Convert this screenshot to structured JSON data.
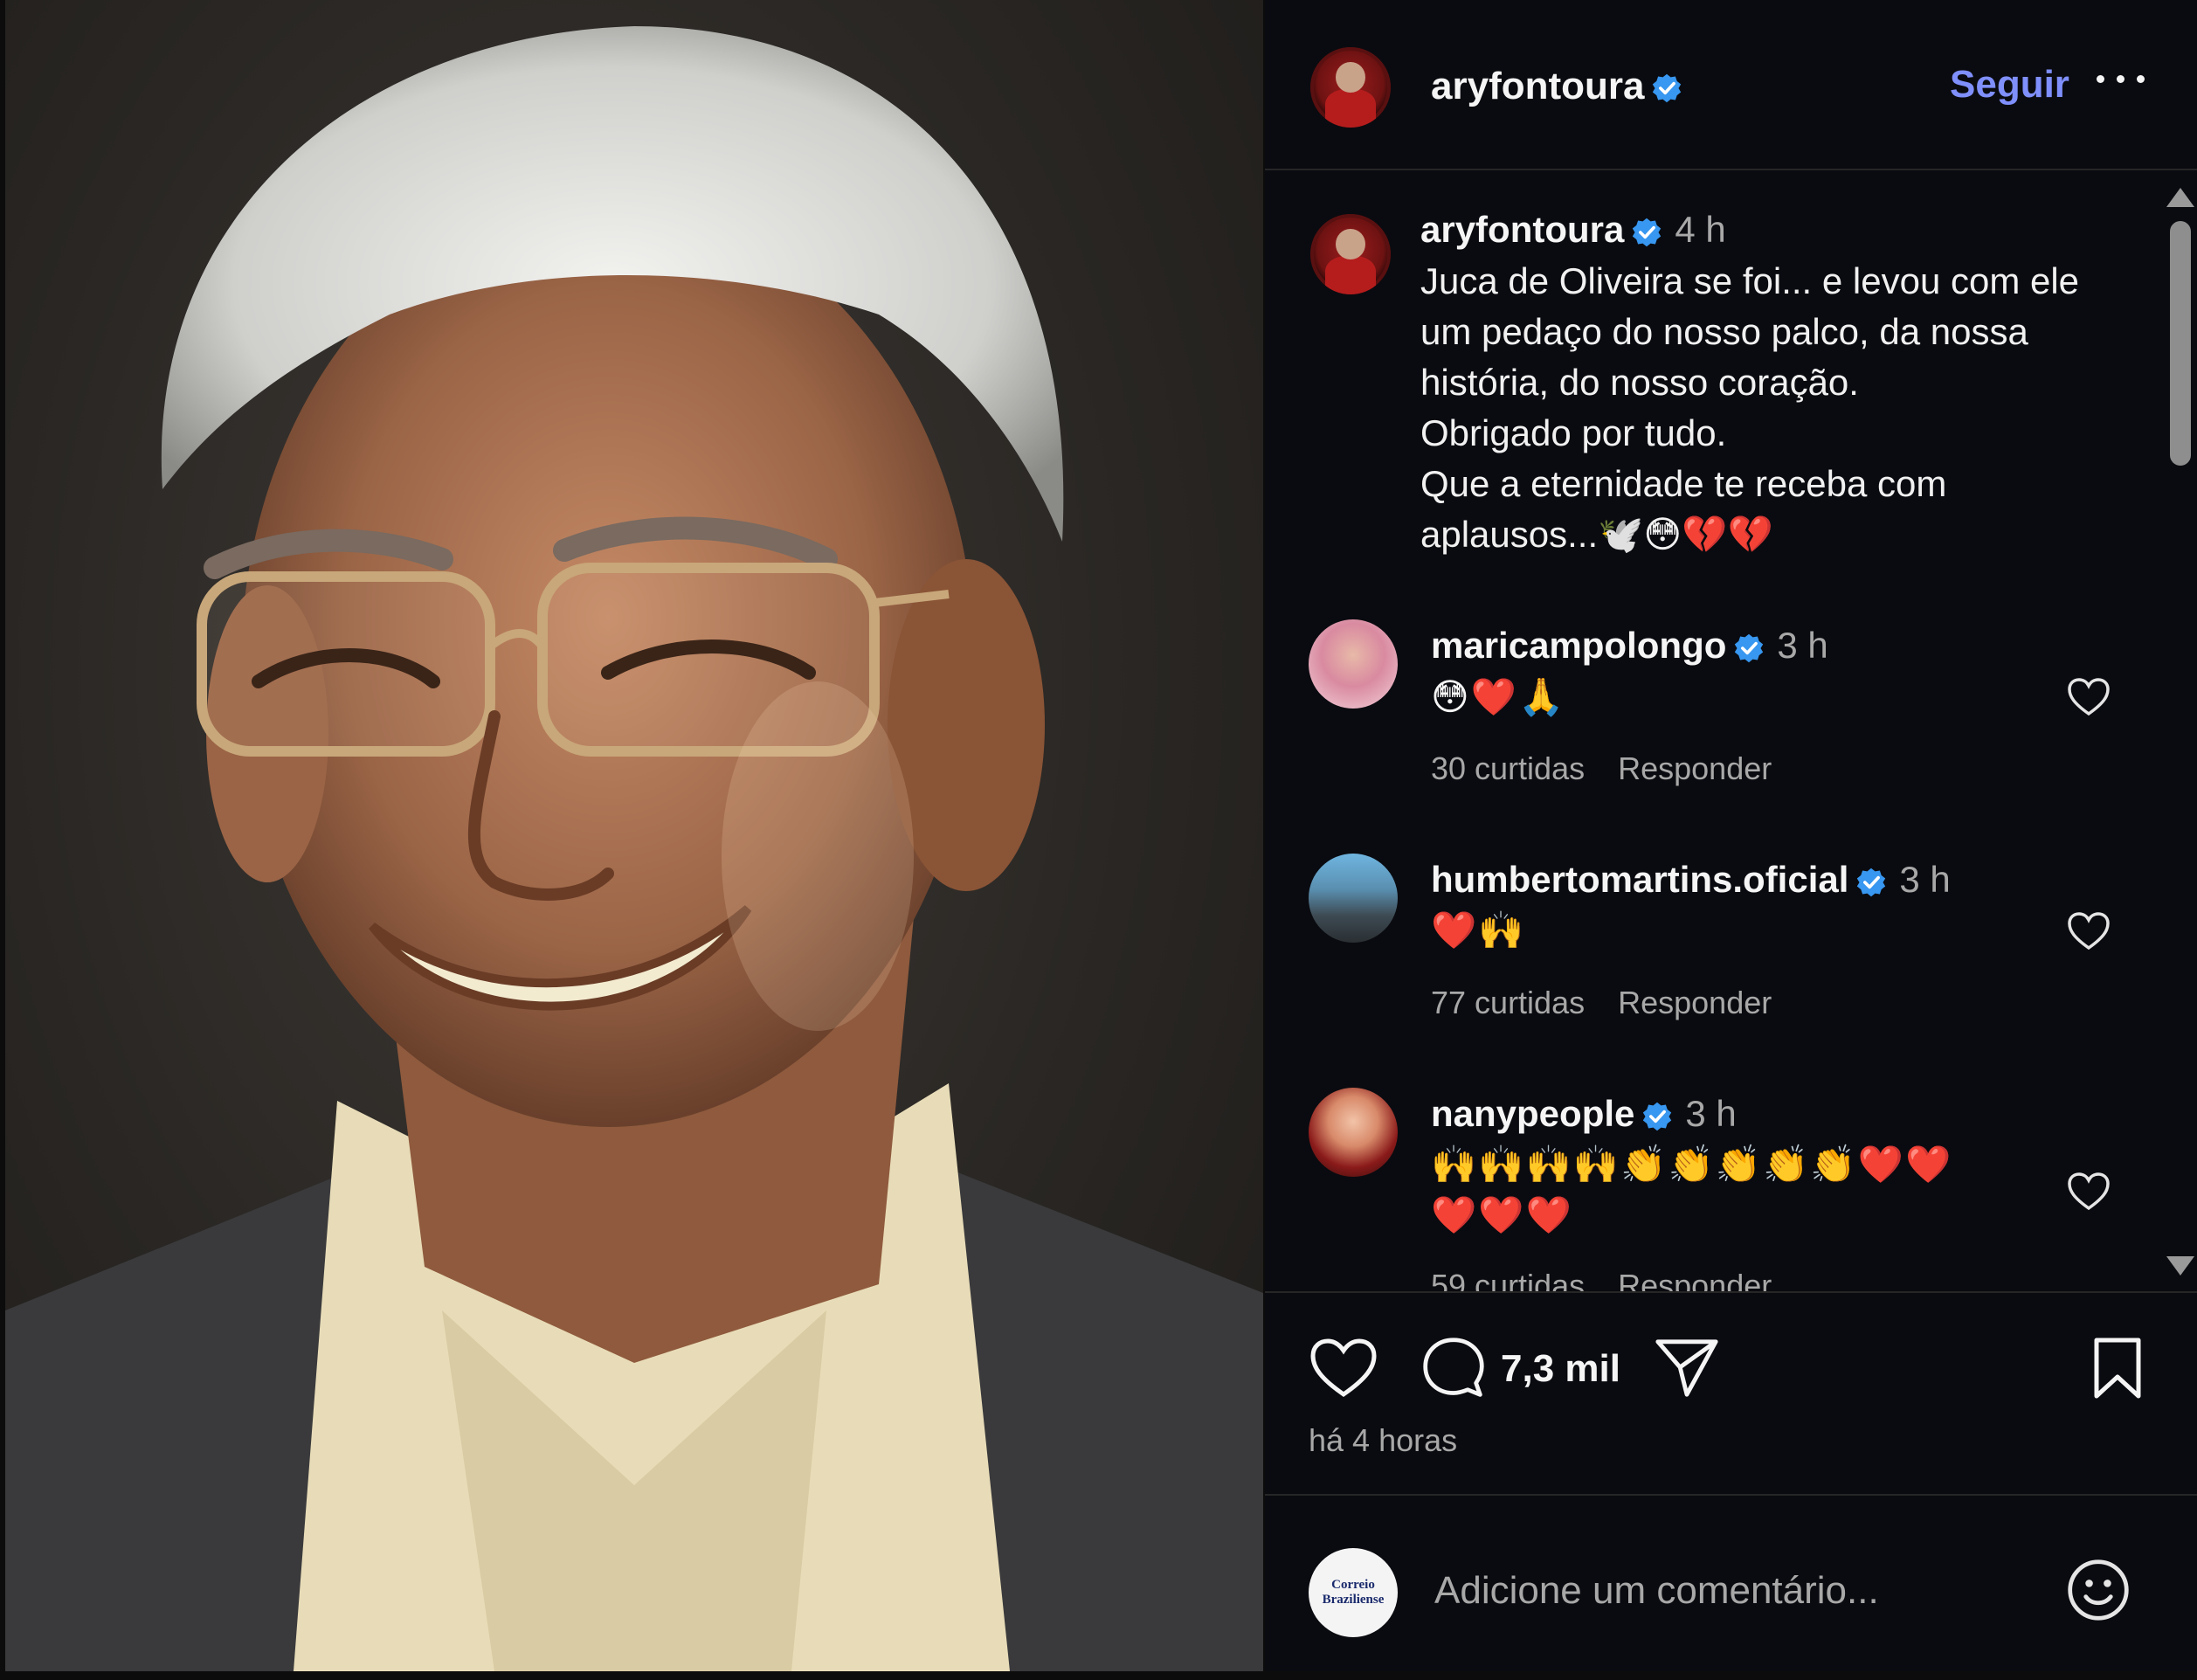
{
  "post": {
    "author": "aryfontoura",
    "follow_label": "Seguir",
    "caption_time": "4 h",
    "caption": "Juca de Oliveira se foi... e levou com ele\num pedaço do nosso palco, da nossa\nhistória, do nosso coração.\nObrigado por tudo.\nQue a eternidade te receba com\naplausos...🕊️😳💔💔",
    "photo_alt": "photo-of-smiling-older-man-with-glasses"
  },
  "comments": [
    {
      "user": "maricampolongo",
      "time": "3 h",
      "text": "😳❤️🙏",
      "likes": "30 curtidas",
      "reply": "Responder"
    },
    {
      "user": "humbertomartins.oficial",
      "time": "3 h",
      "text": "❤️🙌",
      "likes": "77 curtidas",
      "reply": "Responder"
    },
    {
      "user": "nanypeople",
      "time": "3 h",
      "text": "🙌🙌🙌🙌👏👏👏👏👏❤️❤️",
      "text2": "❤️❤️❤️",
      "likes": "59 curtidas",
      "reply": "Responder"
    }
  ],
  "actions": {
    "comment_count": "7,3 mil",
    "posted_ago": "há 4 horas"
  },
  "add_comment": {
    "placeholder": "Adicione um comentário...",
    "avatar_line1": "Correio",
    "avatar_line2": "Braziliense"
  },
  "colors": {
    "panel_bg": "#0a0b10",
    "accent_follow": "#7f8ffb",
    "verified_blue": "#3897f0",
    "muted_text": "#a8a8a8"
  },
  "icons": [
    "verified-badge-icon",
    "more-options-icon",
    "heart-icon",
    "comment-icon",
    "share-icon",
    "bookmark-icon",
    "emoji-icon",
    "scroll-up-arrow-icon",
    "scroll-down-arrow-icon"
  ]
}
